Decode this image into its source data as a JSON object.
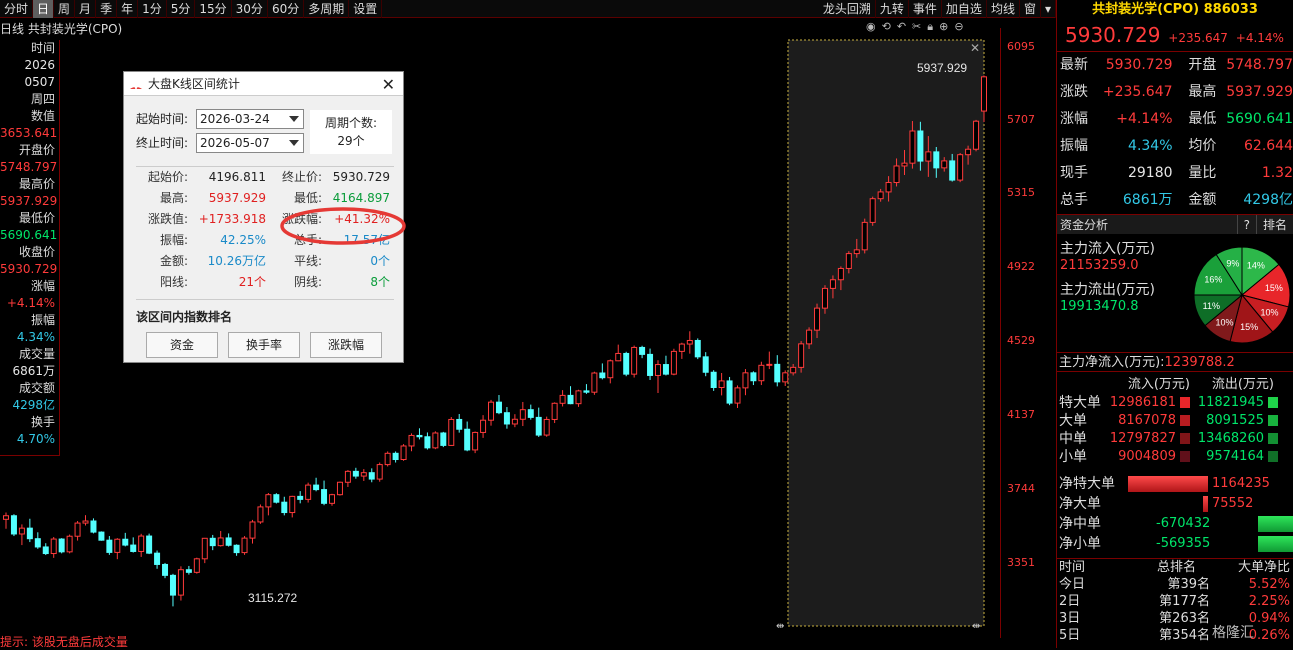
{
  "topbar": {
    "items": [
      "分时",
      "日",
      "周",
      "月",
      "季",
      "年",
      "1分",
      "5分",
      "15分",
      "30分",
      "60分",
      "多周期",
      "设置"
    ],
    "active_index": 1,
    "right_items": [
      "龙头回溯",
      "九转",
      "事件",
      "加自选",
      "均线",
      "窗",
      "▾"
    ]
  },
  "subtitle": "日线  共封装光学(CPO)",
  "left_panel": [
    {
      "label": "时间",
      "value": "2026"
    },
    {
      "label": "",
      "value": "0507"
    },
    {
      "label": "周四",
      "value": ""
    },
    {
      "label": "数值",
      "value": "3653.641"
    },
    {
      "label": "开盘价",
      "value": "5748.797"
    },
    {
      "label": "最高价",
      "value": "5937.929"
    },
    {
      "label": "最低价",
      "value": "5690.641"
    },
    {
      "label": "收盘价",
      "value": "5930.729"
    },
    {
      "label": "涨幅",
      "value": "+4.14%"
    },
    {
      "label": "振幅",
      "value": "4.34%"
    },
    {
      "label": "成交量",
      "value": "6861万"
    },
    {
      "label": "成交额",
      "value": "4298亿"
    },
    {
      "label": "换手",
      "value": "4.70%"
    }
  ],
  "yaxis": [
    "6095",
    "5707",
    "5315",
    "4922",
    "4529",
    "4137",
    "3744",
    "3351"
  ],
  "annotations": {
    "high_label": "5937.929",
    "low_label": "3115.272"
  },
  "status": "提示: 该股无盘后成交量",
  "right": {
    "title": "共封装光学(CPO) 886033",
    "price": "5930.729",
    "change": "+235.647",
    "pct": "+4.14%",
    "quote": [
      [
        "最新",
        "5930.729",
        "开盘",
        "5748.797"
      ],
      [
        "涨跌",
        "+235.647",
        "最高",
        "5937.929"
      ],
      [
        "涨幅",
        "+4.14%",
        "最低",
        "5690.641"
      ],
      [
        "振幅",
        "4.34%",
        "均价",
        "62.644"
      ],
      [
        "现手",
        "29180",
        "量比",
        "1.32"
      ],
      [
        "总手",
        "6861万",
        "金额",
        "4298亿"
      ]
    ],
    "fund_header": "资金分析",
    "fund_tabs": [
      "?",
      "排名"
    ],
    "inflow_label": "主力流入(万元)",
    "inflow_value": "21153259.0",
    "outflow_label": "主力流出(万元)",
    "outflow_value": "19913470.8",
    "net_label": "主力净流入(万元):",
    "net_value": "1239788.2",
    "pie": [
      {
        "pct": "14%",
        "color": "#2db84a"
      },
      {
        "pct": "15%",
        "color": "#e8262a"
      },
      {
        "pct": "10%",
        "color": "#c81e22"
      },
      {
        "pct": "15%",
        "color": "#a01518"
      },
      {
        "pct": "10%",
        "color": "#80191b"
      },
      {
        "pct": "11%",
        "color": "#0e6e27"
      },
      {
        "pct": "16%",
        "color": "#1aa03a"
      },
      {
        "pct": "9%",
        "color": "#25b046"
      }
    ],
    "order_header": [
      "流入(万元)",
      "流出(万元)"
    ],
    "orders": [
      [
        "特大单",
        "12986181",
        "11821945"
      ],
      [
        "大单",
        "8167078",
        "8091525"
      ],
      [
        "中单",
        "12797827",
        "13468260"
      ],
      [
        "小单",
        "9004809",
        "9574164"
      ]
    ],
    "net_orders": [
      [
        "净特大单",
        "1164235"
      ],
      [
        "净大单",
        "75552"
      ],
      [
        "净中单",
        "-670432"
      ],
      [
        "净小单",
        "-569355"
      ]
    ],
    "rank_header": [
      "时间",
      "总排名",
      "大单净比"
    ],
    "rank": [
      [
        "今日",
        "第",
        "39名",
        "5.52%"
      ],
      [
        "2日",
        "第",
        "177名",
        "2.25%"
      ],
      [
        "3日",
        "第",
        "263名",
        "0.94%"
      ],
      [
        "5日",
        "第",
        "354名",
        "0.26%"
      ]
    ],
    "watermark": "格隆汇"
  },
  "dialog": {
    "title": "大盘K线区间统计",
    "start_label": "起始时间:",
    "start_value": "2026-03-24",
    "end_label": "终止时间:",
    "end_value": "2026-05-07",
    "period_label": "周期个数:",
    "period_value": "29个",
    "stats": [
      [
        "起始价:",
        "4196.811",
        "终止价:",
        "5930.729"
      ],
      [
        "最高:",
        "5937.929",
        "最低:",
        "4164.897"
      ],
      [
        "涨跌值:",
        "+1733.918",
        "涨跌幅:",
        "+41.32%"
      ],
      [
        "振幅:",
        "42.25%",
        "总手:",
        "17.57亿"
      ],
      [
        "金额:",
        "10.26万亿",
        "平线:",
        "0个"
      ],
      [
        "阳线:",
        "21个",
        "阴线:",
        "8个"
      ]
    ],
    "rank_label": "该区间内指数排名",
    "buttons": [
      "资金",
      "换手率",
      "涨跌幅"
    ]
  },
  "candles": [
    [
      3578,
      3614,
      3528,
      3597
    ],
    [
      3597,
      3605,
      3489,
      3500
    ],
    [
      3500,
      3551,
      3441,
      3531
    ],
    [
      3531,
      3581,
      3457,
      3475
    ],
    [
      3475,
      3509,
      3421,
      3431
    ],
    [
      3431,
      3451,
      3388,
      3396
    ],
    [
      3396,
      3484,
      3373,
      3473
    ],
    [
      3473,
      3478,
      3397,
      3405
    ],
    [
      3405,
      3497,
      3397,
      3488
    ],
    [
      3488,
      3569,
      3465,
      3558
    ],
    [
      3558,
      3600,
      3545,
      3569
    ],
    [
      3569,
      3583,
      3503,
      3510
    ],
    [
      3510,
      3514,
      3464,
      3467
    ],
    [
      3467,
      3489,
      3389,
      3402
    ],
    [
      3402,
      3478,
      3366,
      3472
    ],
    [
      3472,
      3506,
      3434,
      3441
    ],
    [
      3441,
      3482,
      3401,
      3407
    ],
    [
      3407,
      3501,
      3378,
      3489
    ],
    [
      3489,
      3502,
      3393,
      3398
    ],
    [
      3398,
      3412,
      3315,
      3338
    ],
    [
      3338,
      3346,
      3265,
      3280
    ],
    [
      3280,
      3288,
      3115,
      3175
    ],
    [
      3175,
      3328,
      3146,
      3310
    ],
    [
      3310,
      3330,
      3284,
      3296
    ],
    [
      3296,
      3374,
      3289,
      3368
    ],
    [
      3368,
      3479,
      3345,
      3477
    ],
    [
      3477,
      3495,
      3414,
      3438
    ],
    [
      3438,
      3516,
      3433,
      3479
    ],
    [
      3479,
      3503,
      3433,
      3440
    ],
    [
      3440,
      3445,
      3384,
      3401
    ],
    [
      3401,
      3489,
      3389,
      3478
    ],
    [
      3478,
      3575,
      3449,
      3564
    ],
    [
      3564,
      3657,
      3554,
      3644
    ],
    [
      3644,
      3718,
      3599,
      3709
    ],
    [
      3709,
      3717,
      3662,
      3669
    ],
    [
      3669,
      3698,
      3599,
      3614
    ],
    [
      3614,
      3703,
      3588,
      3700
    ],
    [
      3700,
      3728,
      3663,
      3684
    ],
    [
      3684,
      3773,
      3667,
      3760
    ],
    [
      3760,
      3799,
      3727,
      3736
    ],
    [
      3736,
      3784,
      3653,
      3663
    ],
    [
      3663,
      3714,
      3650,
      3709
    ],
    [
      3709,
      3779,
      3704,
      3775
    ],
    [
      3775,
      3840,
      3750,
      3833
    ],
    [
      3833,
      3852,
      3794,
      3808
    ],
    [
      3808,
      3845,
      3782,
      3826
    ],
    [
      3826,
      3849,
      3775,
      3792
    ],
    [
      3792,
      3880,
      3778,
      3869
    ],
    [
      3869,
      3939,
      3859,
      3929
    ],
    [
      3929,
      3939,
      3880,
      3896
    ],
    [
      3896,
      3978,
      3889,
      3968
    ],
    [
      3968,
      4035,
      3940,
      4024
    ],
    [
      4024,
      4062,
      4003,
      4017
    ],
    [
      4017,
      4040,
      3949,
      3958
    ],
    [
      3958,
      4046,
      3951,
      4037
    ],
    [
      4037,
      4043,
      3962,
      3971
    ],
    [
      3971,
      4122,
      3969,
      4109
    ],
    [
      4109,
      4138,
      4039,
      4057
    ],
    [
      4057,
      4098,
      3940,
      3947
    ],
    [
      3947,
      4045,
      3930,
      4040
    ],
    [
      4040,
      4132,
      4011,
      4105
    ],
    [
      4105,
      4213,
      4076,
      4201
    ],
    [
      4201,
      4239,
      4137,
      4145
    ],
    [
      4145,
      4175,
      4060,
      4085
    ],
    [
      4085,
      4137,
      4068,
      4110
    ],
    [
      4110,
      4202,
      4074,
      4161
    ],
    [
      4161,
      4188,
      4108,
      4120
    ],
    [
      4120,
      4172,
      4016,
      4026
    ],
    [
      4026,
      4124,
      4017,
      4109
    ],
    [
      4109,
      4200,
      4090,
      4195
    ],
    [
      4195,
      4265,
      4178,
      4237
    ],
    [
      4237,
      4286,
      4190,
      4193
    ],
    [
      4193,
      4267,
      4176,
      4261
    ],
    [
      4261,
      4297,
      4245,
      4254
    ],
    [
      4254,
      4363,
      4240,
      4356
    ],
    [
      4356,
      4407,
      4322,
      4331
    ],
    [
      4331,
      4428,
      4301,
      4421
    ],
    [
      4421,
      4507,
      4419,
      4460
    ],
    [
      4460,
      4469,
      4339,
      4350
    ],
    [
      4350,
      4502,
      4332,
      4492
    ],
    [
      4492,
      4501,
      4435,
      4455
    ],
    [
      4455,
      4486,
      4319,
      4343
    ],
    [
      4343,
      4424,
      4250,
      4401
    ],
    [
      4401,
      4448,
      4343,
      4350
    ],
    [
      4350,
      4485,
      4344,
      4471
    ],
    [
      4471,
      4517,
      4431,
      4510
    ],
    [
      4510,
      4578,
      4459,
      4529
    ],
    [
      4529,
      4540,
      4430,
      4442
    ],
    [
      4442,
      4467,
      4339,
      4360
    ],
    [
      4360,
      4371,
      4261,
      4279
    ],
    [
      4279,
      4356,
      4237,
      4314
    ],
    [
      4314,
      4335,
      4185,
      4196
    ],
    [
      4196,
      4290,
      4170,
      4277
    ],
    [
      4277,
      4377,
      4238,
      4357
    ],
    [
      4357,
      4365,
      4292,
      4315
    ],
    [
      4315,
      4416,
      4292,
      4397
    ],
    [
      4397,
      4470,
      4377,
      4402
    ],
    [
      4402,
      4451,
      4285,
      4309
    ],
    [
      4309,
      4370,
      4287,
      4357
    ],
    [
      4357,
      4404,
      4343,
      4386
    ],
    [
      4386,
      4526,
      4358,
      4511
    ],
    [
      4511,
      4599,
      4484,
      4584
    ],
    [
      4584,
      4725,
      4542,
      4701
    ],
    [
      4701,
      4823,
      4671,
      4806
    ],
    [
      4806,
      4875,
      4753,
      4852
    ],
    [
      4852,
      4923,
      4797,
      4912
    ],
    [
      4912,
      5004,
      4886,
      4991
    ],
    [
      4991,
      5069,
      4969,
      5011
    ],
    [
      5011,
      5177,
      4992,
      5157
    ],
    [
      5157,
      5294,
      5139,
      5283
    ],
    [
      5283,
      5335,
      5267,
      5319
    ],
    [
      5319,
      5403,
      5268,
      5369
    ],
    [
      5369,
      5497,
      5348,
      5457
    ],
    [
      5457,
      5542,
      5409,
      5472
    ],
    [
      5472,
      5696,
      5443,
      5643
    ],
    [
      5643,
      5692,
      5432,
      5483
    ],
    [
      5483,
      5616,
      5399,
      5532
    ],
    [
      5532,
      5558,
      5394,
      5447
    ],
    [
      5447,
      5504,
      5427,
      5484
    ],
    [
      5484,
      5521,
      5374,
      5382
    ],
    [
      5382,
      5526,
      5371,
      5517
    ],
    [
      5517,
      5565,
      5464,
      5546
    ],
    [
      5546,
      5702,
      5535,
      5695
    ],
    [
      5749,
      5938,
      5691,
      5931
    ]
  ]
}
